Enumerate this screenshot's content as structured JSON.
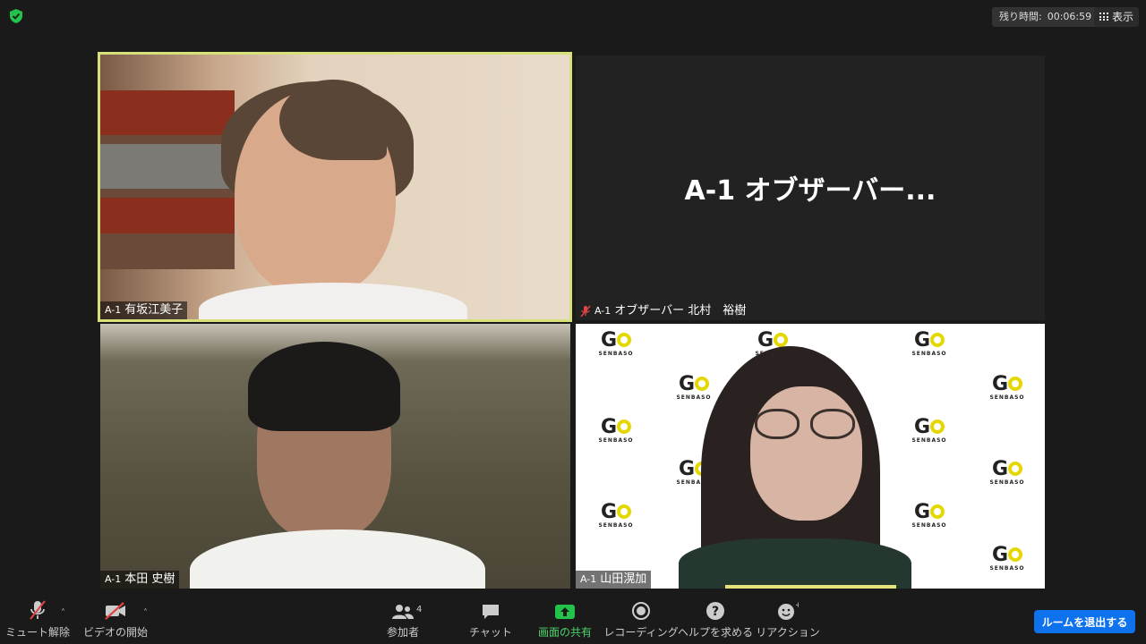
{
  "top": {
    "timer_label": "残り時間:",
    "timer_value": "00:06:59",
    "view_label": "表示"
  },
  "tiles": [
    {
      "tag": "A-1",
      "name": "有坂江美子"
    },
    {
      "title": "A-1 オブザーバー...",
      "tag": "A-1",
      "name": "オブザーバー 北村　裕樹"
    },
    {
      "tag": "A-1",
      "name": "本田 史樹"
    },
    {
      "tag": "A-1",
      "name": "山田滉加",
      "logo_word": "G",
      "logo_sub": "SENBASO"
    }
  ],
  "toolbar": {
    "mute": "ミュート解除",
    "video": "ビデオの開始",
    "participants": "参加者",
    "participants_count": "4",
    "chat": "チャット",
    "share": "画面の共有",
    "record": "レコーディング",
    "help": "ヘルプを求める",
    "reaction": "リアクション",
    "leave": "ルームを退出する"
  },
  "colors": {
    "active_speaker": "#d8e07a",
    "share_green": "#4fd46b",
    "leave_blue": "#0e72ed",
    "logo_yellow": "#e5d700"
  },
  "icons": [
    "shield-icon",
    "grid-icon",
    "mic-muted-icon",
    "video-off-icon",
    "participants-icon",
    "chat-icon",
    "share-screen-icon",
    "record-icon",
    "help-icon",
    "reaction-icon",
    "caret-up-icon"
  ]
}
